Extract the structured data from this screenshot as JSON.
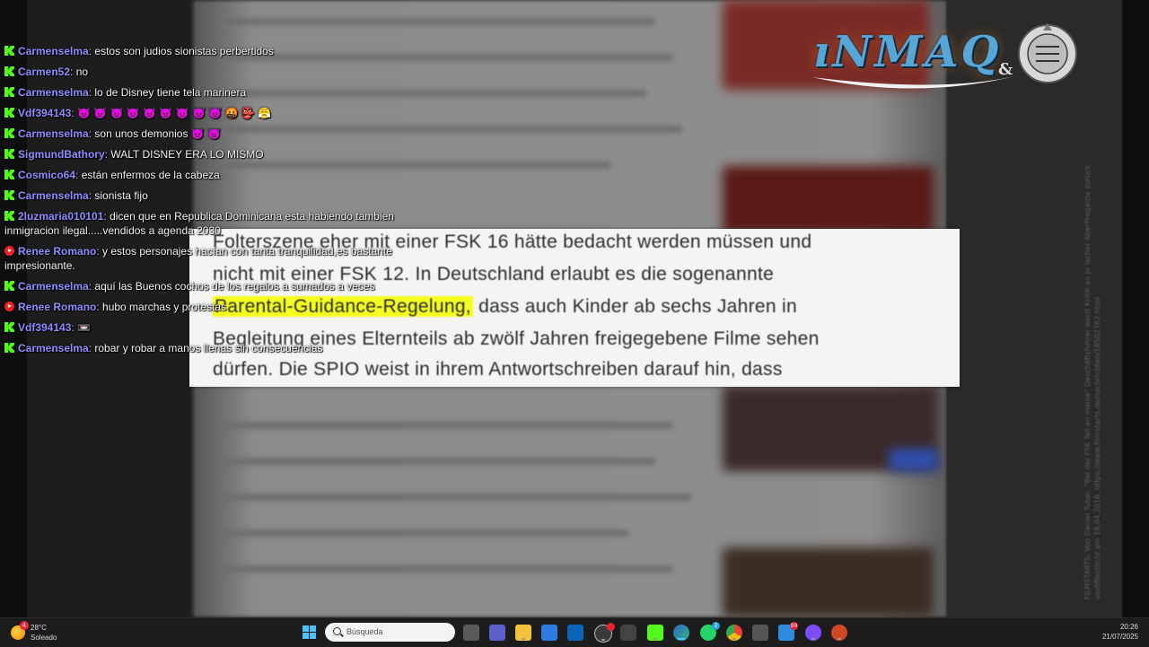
{
  "article": {
    "line1": "Folterszene eher mit einer FSK 16 hätte bedacht werden müssen und",
    "line2": "nicht mit einer FSK 12. In Deutschland erlaubt es die sogenannte",
    "line3_highlight": "Parental-Guidance-Regelung,",
    "line3_rest": " dass auch Kinder ab sechs Jahren in",
    "line4": "Begleitung eines Elternteils ab zwölf Jahren freigegebene Filme sehen",
    "line5": "dürfen. Die SPIO weist in ihrem Antwortschreiben darauf hin, dass",
    "highlight_color": "#f5ff20"
  },
  "logo": {
    "text": "INMAQ",
    "amp": "&"
  },
  "chat": {
    "messages": [
      {
        "platform": "kick",
        "user": "Carmenselma",
        "text": "estos son judios sionistas perbertidos"
      },
      {
        "platform": "kick",
        "user": "Carmen52",
        "text": "no"
      },
      {
        "platform": "kick",
        "user": "Carmenselma",
        "text": "lo de Disney tiene tela marinera"
      },
      {
        "platform": "kick",
        "user": "Vdf394143",
        "text": "👿 👿 👿 👿 👿 👿 👿 👿 👿 🤬 👺 😤"
      },
      {
        "platform": "kick",
        "user": "Carmenselma",
        "text": "son unos demonios 👿 👿"
      },
      {
        "platform": "kick",
        "user": "SigmundBathory",
        "text": "WALT DISNEY ERA LO MISMO"
      },
      {
        "platform": "kick",
        "user": "Cosmico64",
        "text": "están enfermos de la cabeza"
      },
      {
        "platform": "kick",
        "user": "Carmenselma",
        "text": "sionista fijo"
      },
      {
        "platform": "kick",
        "user": "2luzmaria010101",
        "text": "dicen que en Republica Dominicana esta habiendo tambien inmigracion ilegal.....vendidos a agenda 2030"
      },
      {
        "platform": "youtube",
        "user": "Renee Romano",
        "text": "y estos personajes hacían con tanta tranquilidad,es bastante impresionante."
      },
      {
        "platform": "kick",
        "user": "Carmenselma",
        "text": "aquí las Buenos cochos de los regalos a sumados a veces"
      },
      {
        "platform": "youtube",
        "user": "Renee Romano",
        "text": "hubo marchas y protestas"
      },
      {
        "platform": "kick",
        "user": "Vdf394143",
        "text": "📼"
      },
      {
        "platform": "kick",
        "user": "Carmenselma",
        "text": "robar y robar a manos llenas sin consecuencias"
      }
    ]
  },
  "watermark": {
    "line1": "FILMSTARTS: Von Daniel Tuber, \"Bei der FSK Teil en meine\" Geschäftsfuhrer weist Kritik an Jo lacher AberPregalzie zurück",
    "line2": "veröffentlicht am 19.04.2016, https://www.filmstarts.de/nachrichten/18502762.html"
  },
  "taskbar": {
    "weather_temp": "28°C",
    "weather_cond": "Soleado",
    "weather_badge": "4",
    "search_placeholder": "Búsqueda",
    "time": "20:26",
    "date": "21/07/2025",
    "badge_whatsapp": "2",
    "badge_app": "99"
  },
  "colors": {
    "username": "#8f8cff",
    "kick": "#53fc18",
    "youtube": "#ee2222"
  }
}
